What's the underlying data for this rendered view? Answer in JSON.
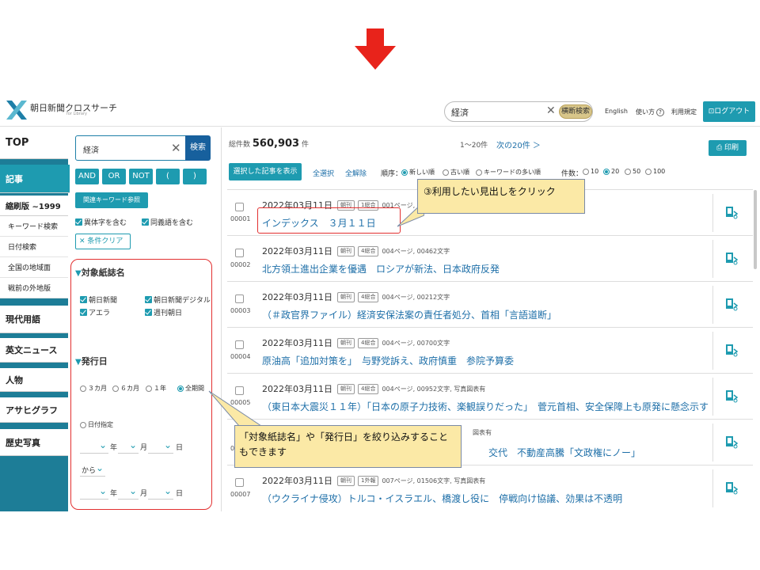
{
  "header": {
    "logo_title": "朝日新聞クロスサーチ",
    "logo_sub": "for Library",
    "search_value": "経済",
    "search_button": "横断検索",
    "links": [
      "English",
      "使い方",
      "利用規定"
    ],
    "logout": "ログアウト"
  },
  "nav": {
    "top": "TOP",
    "kiji": "記事",
    "shukusatsu": "縮刷版 ~1999",
    "subs": [
      "キーワード検索",
      "日付検索",
      "全国の地域面",
      "戦前の外地版"
    ],
    "items": [
      "現代用語",
      "英文ニュース",
      "人物",
      "アサヒグラフ",
      "歴史写真"
    ]
  },
  "filter": {
    "keyword": "経済",
    "search_btn": "検索",
    "ops": [
      "AND",
      "OR",
      "NOT",
      "(",
      ")"
    ],
    "related_btn": "関連キーワード参照",
    "options": [
      "異体字を含む",
      "同義語を含む"
    ],
    "clear_btn": "条件クリア",
    "papers_title": "対象紙誌名",
    "papers": [
      "朝日新聞",
      "朝日新聞デジタル",
      "アエラ",
      "週刊朝日"
    ],
    "date_title": "発行日",
    "periods": [
      "３カ月",
      "６カ月",
      "１年",
      "全期間"
    ],
    "date_specify": "日付指定",
    "ymd": [
      "年",
      "月",
      "日"
    ],
    "from": "から"
  },
  "results": {
    "total_label": "総件数",
    "total": "560,903",
    "total_unit": "件",
    "range": "1～20件",
    "next": "次の20件 ＞",
    "print": "印刷",
    "show_selected": "選択した記事を表示",
    "select_all": "全選択",
    "deselect_all": "全解除",
    "order_label": "順序：",
    "orders": [
      "新しい順",
      "古い順",
      "キーワードの多い順"
    ],
    "count_label": "件数：",
    "counts": [
      "10",
      "20",
      "50",
      "100"
    ],
    "rows": [
      {
        "num": "00001",
        "date": "2022年03月11日",
        "edition": "朝刊",
        "page": "1総合",
        "info": "001ページ,",
        "title": "インデックス　３月１１日"
      },
      {
        "num": "00002",
        "date": "2022年03月11日",
        "edition": "朝刊",
        "page": "4総合",
        "info": "004ページ, 00462文字",
        "title": "北方領土進出企業を優遇　ロシアが新法、日本政府反発"
      },
      {
        "num": "00003",
        "date": "2022年03月11日",
        "edition": "朝刊",
        "page": "4総合",
        "info": "004ページ, 00212文字",
        "title": "（＃政官界ファイル）経済安保法案の責任者処分、首相「言語道断」"
      },
      {
        "num": "00004",
        "date": "2022年03月11日",
        "edition": "朝刊",
        "page": "4総合",
        "info": "004ページ, 00700文字",
        "title": "原油高「追加対策を」　与野党訴え、政府慎重　参院予算委"
      },
      {
        "num": "00005",
        "date": "2022年03月11日",
        "edition": "朝刊",
        "page": "4総合",
        "info": "004ページ, 00952文字, 写真図表有",
        "title": "（東日本大震災１１年）「日本の原子力技術、楽観誤りだった」　菅元首相、安全保障上も原発に懸念示す"
      },
      {
        "num": "00006",
        "date": "",
        "edition": "",
        "page": "",
        "info": "図表有",
        "title": "交代　不動産高騰「文政権にノー」"
      },
      {
        "num": "00007",
        "date": "2022年03月11日",
        "edition": "朝刊",
        "page": "1外報",
        "info": "007ページ, 01506文字, 写真図表有",
        "title": "（ウクライナ侵攻）トルコ・イスラエル、橋渡し役に　停戦向け協議、効果は不透明"
      }
    ]
  },
  "callouts": {
    "c1": "③利用したい見出しをクリック",
    "c2_line1": "「対象紙誌名」や「発行日」を絞り込みすること",
    "c2_line2": "もできます"
  },
  "colors": {
    "accent": "#1e9bb0",
    "nav_bg": "#1d7d97",
    "link": "#1e6fa8",
    "highlight": "#e23030",
    "callout_bg": "#fbe9a6"
  }
}
